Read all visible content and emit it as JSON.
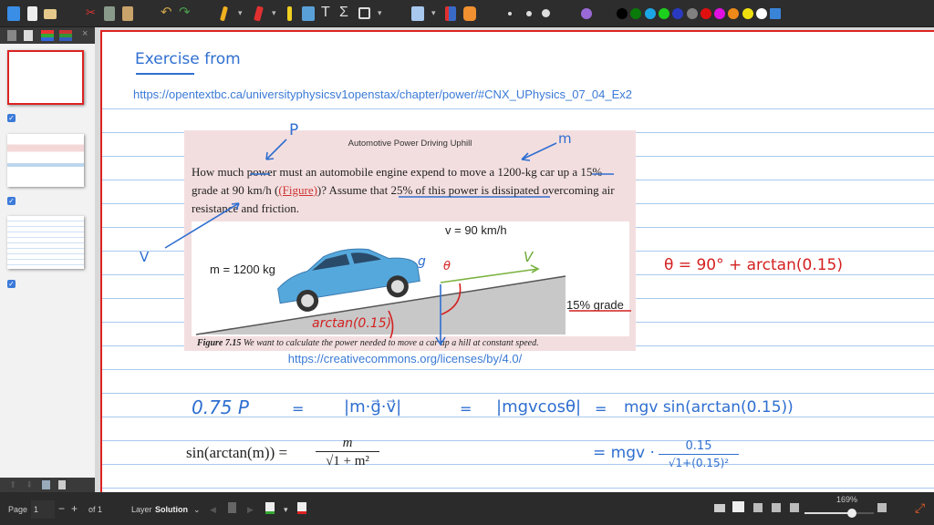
{
  "toolbar": {
    "icons": [
      "save-icon",
      "new-document-icon",
      "open-folder-icon",
      "cut-icon",
      "copy-icon",
      "paste-icon",
      "undo-icon",
      "redo-icon",
      "pen-icon",
      "eraser-icon",
      "highlighter-icon",
      "image-icon",
      "text-icon",
      "latex-sigma-icon",
      "shape-rectangle-icon",
      "select-rectangle-icon",
      "vertical-space-icon",
      "hand-icon",
      "size-small-icon",
      "size-medium-icon",
      "size-large-icon",
      "fill-icon"
    ],
    "text_glyph": "T",
    "sigma_glyph": "Σ",
    "colors": [
      "#000000",
      "#0a7a0a",
      "#1ca6e6",
      "#1ed01e",
      "#2a3ac0",
      "#808080",
      "#e01010",
      "#e010e0",
      "#ee8a1a",
      "#f0e010",
      "#ffffff",
      "#3a84d8"
    ]
  },
  "sidebar": {
    "close": "×",
    "pages": [
      {
        "selected": true
      },
      {
        "selected": false
      },
      {
        "selected": false
      }
    ],
    "check": "✓"
  },
  "page": {
    "exercise_heading": "Exercise from",
    "source_url": "https://opentextbc.ca/universityphysicsv1openstax/chapter/power/#CNX_UPhysics_07_04_Ex2",
    "figure": {
      "title": "Automotive Power Driving Uphill",
      "q1a": "How much ",
      "q1b": "power",
      "q1c": " must an automobile engine expend to move a 1200-kg car up a ",
      "q1d": "15%",
      "q2a": "grade at 90 km/h (",
      "q2b": "(Figure)",
      "q2c": ")? Assume that ",
      "q2d": "25% of this power is dissipated",
      "q2e": " overcoming air",
      "q3": "resistance and friction.",
      "velocity": "v = 90 km/h",
      "mass": "m = 1200 kg",
      "grade": "15% grade",
      "caption_bold": "Figure 7.15",
      "caption": " We want to calculate the power needed to move a car up a hill at constant speed."
    },
    "license_url": "https://creativecommons.org/licenses/by/4.0/",
    "annotations": {
      "p": "P",
      "m": "m",
      "v": "V",
      "g_vec": "g",
      "v_vec": "V",
      "theta": "θ",
      "arctan": "arctan(0.15)",
      "theta_eq": "θ = 90° + arctan(0.15)"
    },
    "equation1": {
      "lhs": "0.75 P",
      "eq": "=",
      "t1": "|m·g⃗·v⃗|",
      "eq2": "=",
      "t2": "|mgvcosθ|",
      "eq3": "=",
      "t3": "mgv sin(arctan(0.15))"
    },
    "identity": {
      "lhs": "sin(arctan(m)) =",
      "num": "m",
      "den": "√1 + m²"
    },
    "equation2": {
      "lhs": "= mgv ·",
      "num": "0.15",
      "den": "√1+(0.15)²"
    }
  },
  "statusbar": {
    "page_label": "Page",
    "page_value": "1",
    "minus": "−",
    "plus": "+",
    "of": "of 1",
    "layer_label": "Layer",
    "layer_value": "Solution",
    "zoom": "169%",
    "zoom_fraction": 0.69
  }
}
